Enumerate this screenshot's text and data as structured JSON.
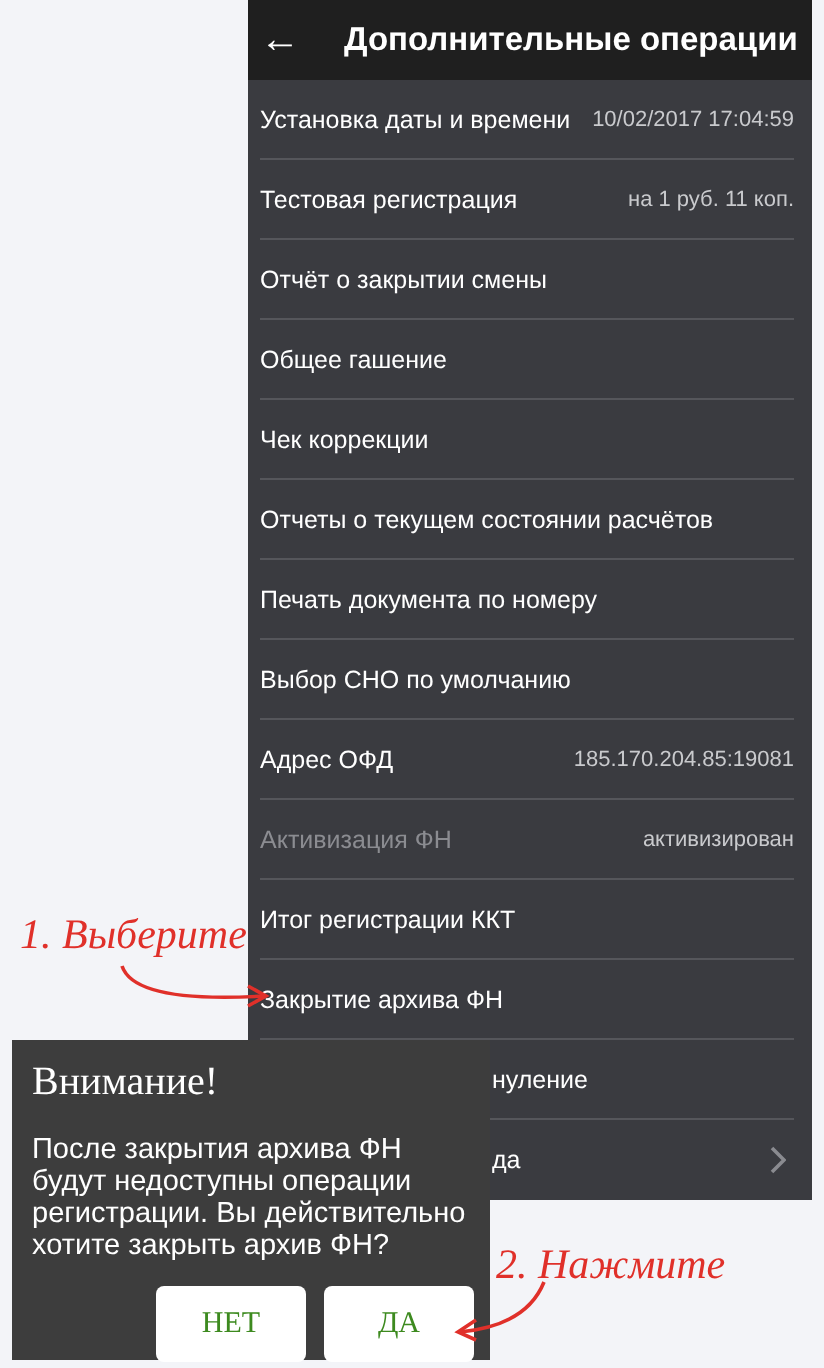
{
  "header": {
    "back_icon": "←",
    "title": "Дополнительные операции"
  },
  "items": [
    {
      "label": "Установка даты и времени",
      "value": "10/02/2017 17:04:59",
      "disabled": false,
      "kind": "plain"
    },
    {
      "label": "Тестовая регистрация",
      "value": "на 1 руб. 11 коп.",
      "disabled": false,
      "kind": "plain"
    },
    {
      "label": "Отчёт о закрытии смены",
      "disabled": false,
      "kind": "plain"
    },
    {
      "label": "Общее гашение",
      "disabled": false,
      "kind": "plain"
    },
    {
      "label": "Чек коррекции",
      "disabled": false,
      "kind": "plain"
    },
    {
      "label": "Отчеты о текущем состоянии расчётов",
      "disabled": false,
      "kind": "plain"
    },
    {
      "label": "Печать документа по номеру",
      "disabled": false,
      "kind": "plain"
    },
    {
      "label": "Выбор СНО по умолчанию",
      "disabled": false,
      "kind": "plain"
    },
    {
      "label": "Адрес ОФД",
      "value": "185.170.204.85:19081",
      "disabled": false,
      "kind": "plain"
    },
    {
      "label": "Активизация ФН",
      "value": "активизирован",
      "disabled": true,
      "kind": "plain"
    },
    {
      "label": "Итог регистрации ККТ",
      "disabled": false,
      "kind": "plain"
    },
    {
      "label": "Закрытие архива ФН",
      "disabled": false,
      "kind": "plain"
    },
    {
      "label": "нуление",
      "disabled": false,
      "kind": "covered"
    },
    {
      "label": "да",
      "disabled": false,
      "kind": "covered_submenu"
    }
  ],
  "dialog": {
    "title": "Внимание!",
    "message": "После закрытия архива ФН будут недоступны операции регистрации. Вы действительно хотите закрыть архив ФН?",
    "buttons": [
      "НЕТ",
      "ДА"
    ]
  },
  "annotations": [
    {
      "text": "1. Выберите"
    },
    {
      "text": "2. Нажмите"
    }
  ]
}
